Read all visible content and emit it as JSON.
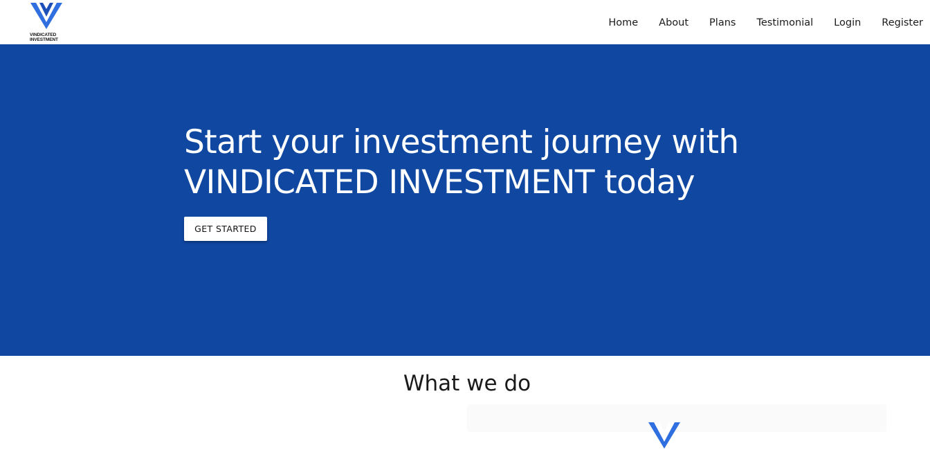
{
  "brand": {
    "name_line1": "VINDICATED",
    "name_line2": "INVESTMENT",
    "logo_icon": "vi-logo-icon",
    "colors": {
      "logo_blue": "#2f6fe0"
    }
  },
  "nav": {
    "items": [
      {
        "label": "Home"
      },
      {
        "label": "About"
      },
      {
        "label": "Plans"
      },
      {
        "label": "Testimonial"
      },
      {
        "label": "Login"
      },
      {
        "label": "Register"
      }
    ]
  },
  "hero": {
    "title": "Start your investment journey with VINDICATED INVESTMENT today",
    "cta_label": "GET STARTED",
    "background_color": "#0f47a1"
  },
  "services": {
    "title": "What we do",
    "card_icon": "vi-logo-icon"
  }
}
